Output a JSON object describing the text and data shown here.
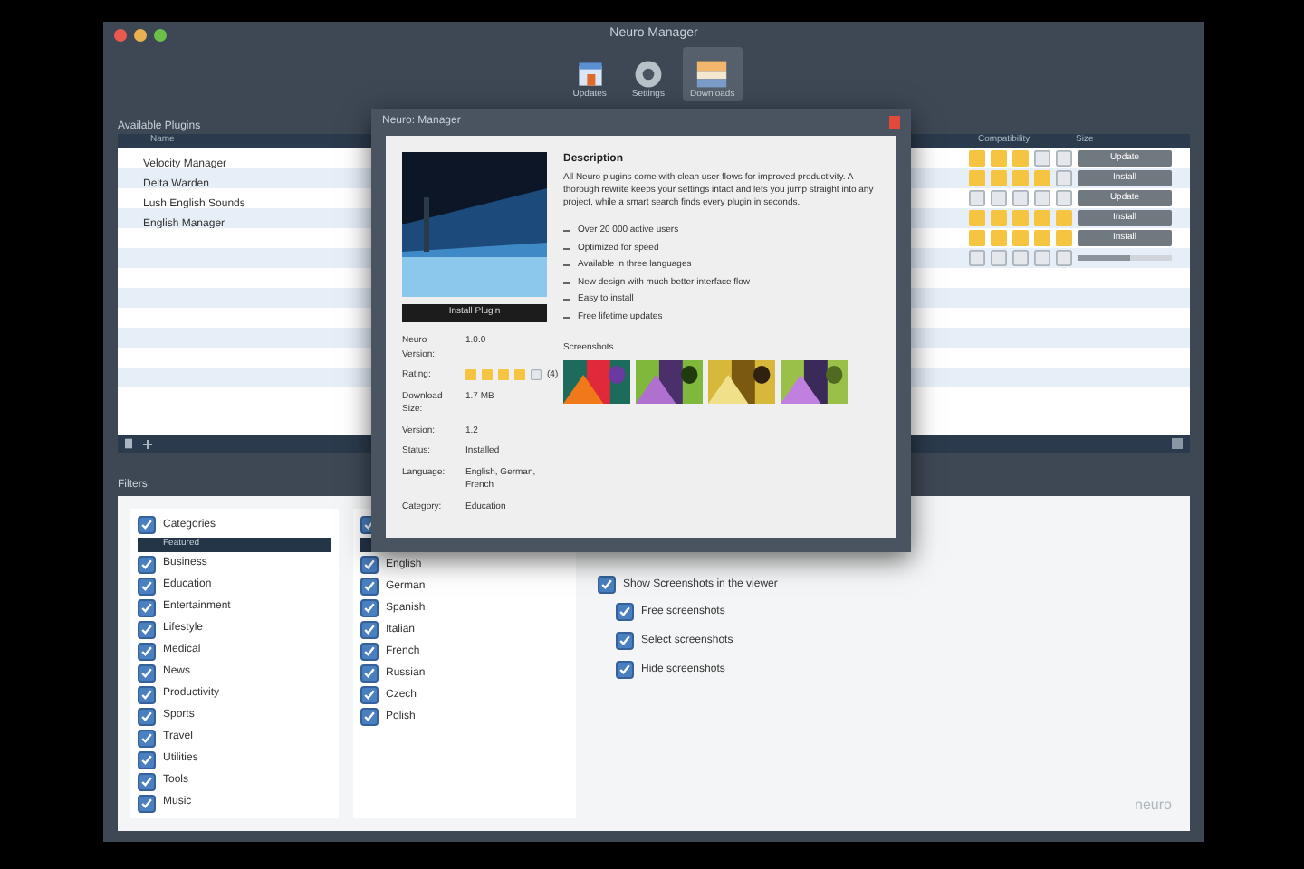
{
  "window": {
    "title": "Neuro Manager"
  },
  "toolbar": [
    {
      "label": "Updates",
      "kind": "box",
      "selected": false
    },
    {
      "label": "Settings",
      "kind": "gear",
      "selected": false
    },
    {
      "label": "Downloads",
      "kind": "stack",
      "selected": true
    }
  ],
  "plugins": {
    "title": "Available Plugins",
    "columns": [
      "Name",
      "Compatibility",
      "Size"
    ],
    "rows": [
      {
        "name": "Velocity Manager",
        "stars": 3,
        "action": {
          "kind": "button",
          "label": "Update"
        }
      },
      {
        "name": "Delta Warden",
        "stars": 4,
        "action": {
          "kind": "button",
          "label": "Install"
        }
      },
      {
        "name": "Lush English Sounds",
        "stars": 0,
        "action": {
          "kind": "button",
          "label": "Update"
        }
      },
      {
        "name": "English Manager",
        "stars": 5,
        "action": {
          "kind": "button",
          "label": "Install"
        }
      },
      {
        "stars": 5,
        "action": {
          "kind": "button",
          "label": "Install"
        }
      },
      {
        "stars": 0,
        "action": {
          "kind": "progress",
          "level": 0.55
        }
      }
    ]
  },
  "filters": {
    "title": "Filters",
    "categories": {
      "label": "Categories",
      "checked": true,
      "header": "Featured",
      "items": [
        {
          "label": "Business",
          "checked": true
        },
        {
          "label": "Education",
          "checked": true
        },
        {
          "label": "Entertainment",
          "checked": true
        },
        {
          "label": "Lifestyle",
          "checked": true
        },
        {
          "label": "Medical",
          "checked": true
        },
        {
          "label": "News",
          "checked": true
        },
        {
          "label": "Productivity",
          "checked": true
        },
        {
          "label": "Sports",
          "checked": true
        },
        {
          "label": "Travel",
          "checked": true
        },
        {
          "label": "Utilities",
          "checked": true
        },
        {
          "label": "Tools",
          "checked": true
        },
        {
          "label": "Music",
          "checked": true
        }
      ]
    },
    "languages": {
      "checked": true,
      "items": [
        {
          "label": "English",
          "checked": true
        },
        {
          "label": "German",
          "checked": true
        },
        {
          "label": "Spanish",
          "checked": true
        },
        {
          "label": "Italian",
          "checked": true
        },
        {
          "label": "French",
          "checked": true
        },
        {
          "label": "Russian",
          "checked": true
        },
        {
          "label": "Czech",
          "checked": true
        },
        {
          "label": "Polish",
          "checked": true
        }
      ]
    },
    "options": {
      "label": "Show Screenshots in the viewer",
      "checked": true,
      "items": [
        {
          "label": "Free screenshots",
          "checked": true
        },
        {
          "label": "Select screenshots",
          "checked": true
        },
        {
          "label": "Hide screenshots",
          "checked": true
        }
      ]
    },
    "logo": "neuro"
  },
  "dialog": {
    "title": "Neuro: Manager",
    "install_button": "Install Plugin",
    "info": [
      {
        "label": "Neuro Version:",
        "value": "1.0.0"
      },
      {
        "label": "Rating:",
        "stars": 4,
        "value": "(4)"
      },
      {
        "label": "Download Size:",
        "value": "1.7 MB"
      },
      {
        "label": "Version:",
        "value": "1.2"
      },
      {
        "label": "Status:",
        "value": "Installed"
      },
      {
        "label": "Language:",
        "value": "English, German, French"
      },
      {
        "label": "Category:",
        "value": "Education"
      }
    ],
    "description_title": "Description",
    "description": "All Neuro plugins come with clean user flows for improved productivity. A thorough rewrite keeps your settings intact and lets you jump straight into any project, while a smart search finds every plugin in seconds.",
    "features": [
      "Over 20 000 active users",
      "Optimized for speed",
      "Available in three languages",
      "New design with much better interface flow",
      "Easy to install",
      "Free lifetime updates"
    ],
    "screenshots_title": "Screenshots",
    "screenshots": [
      {
        "kind": "picture"
      },
      {
        "kind": "picture"
      },
      {
        "kind": "picture"
      },
      {
        "kind": "picture"
      }
    ]
  }
}
